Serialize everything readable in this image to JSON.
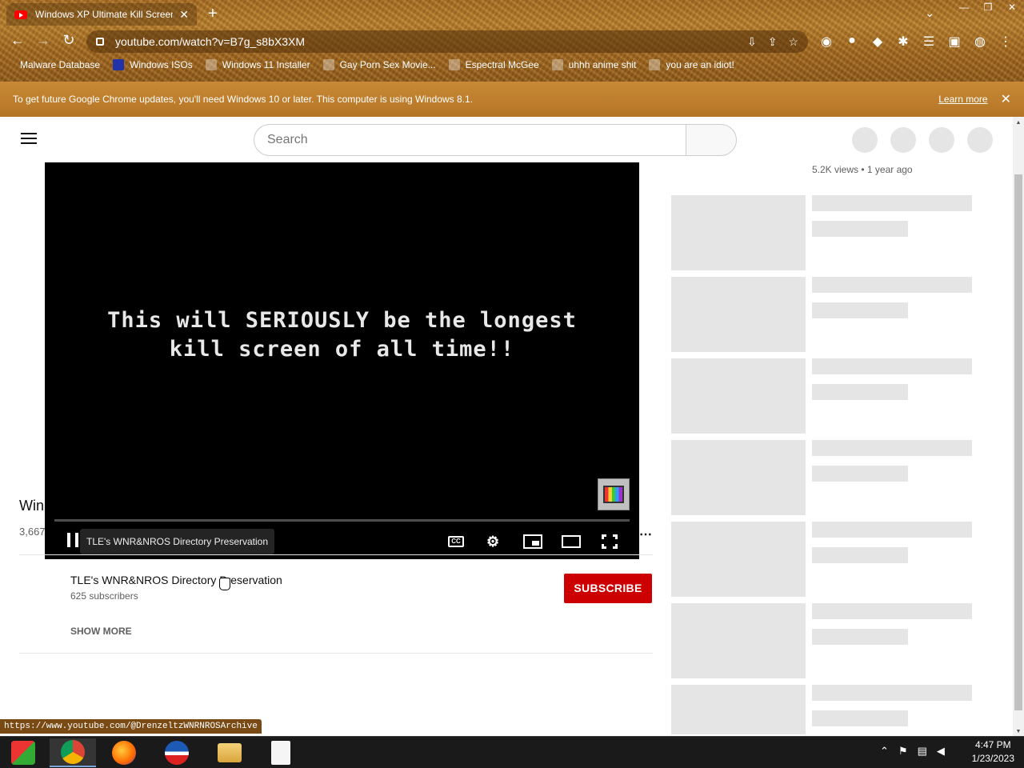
{
  "browser": {
    "tab_title": "Windows XP Ultimate Kill Screen",
    "tab_close": "✕",
    "new_tab": "+",
    "url": "youtube.com/watch?v=B7g_s8bX3XM",
    "bookmarks": [
      "Malware Database",
      "Windows ISOs",
      "Windows 11 Installer",
      "Gay Porn Sex Movie...",
      "Espectral McGee",
      "uhhh anime shit",
      "you are an idiot!"
    ],
    "infobar_message": "To get future Google Chrome updates, you'll need Windows 10 or later. This computer is using Windows 8.1.",
    "infobar_link": "Learn more",
    "status_url": "https://www.youtube.com/@DrenzeltzWNRNROSArchive"
  },
  "youtube": {
    "search_placeholder": "Search",
    "video_text_line1": "This will SERIOUSLY be the longest",
    "video_text_line2": "kill screen of all time!!",
    "tooltip": "TLE's WNR&NROS Directory Preservation",
    "title_partial": "Win",
    "views_partial": "3,667",
    "channel_name": "TLE's WNR&NROS Directory Preservation",
    "subscribers": "625 subscribers",
    "subscribe_label": "SUBSCRIBE",
    "show_more": "SHOW MORE",
    "side_meta": "5.2K views  • 1 year ago",
    "cc_label": "CC",
    "recommendation_placeholders": 7
  },
  "taskbar": {
    "time": "4:47 PM",
    "date": "1/23/2023"
  }
}
